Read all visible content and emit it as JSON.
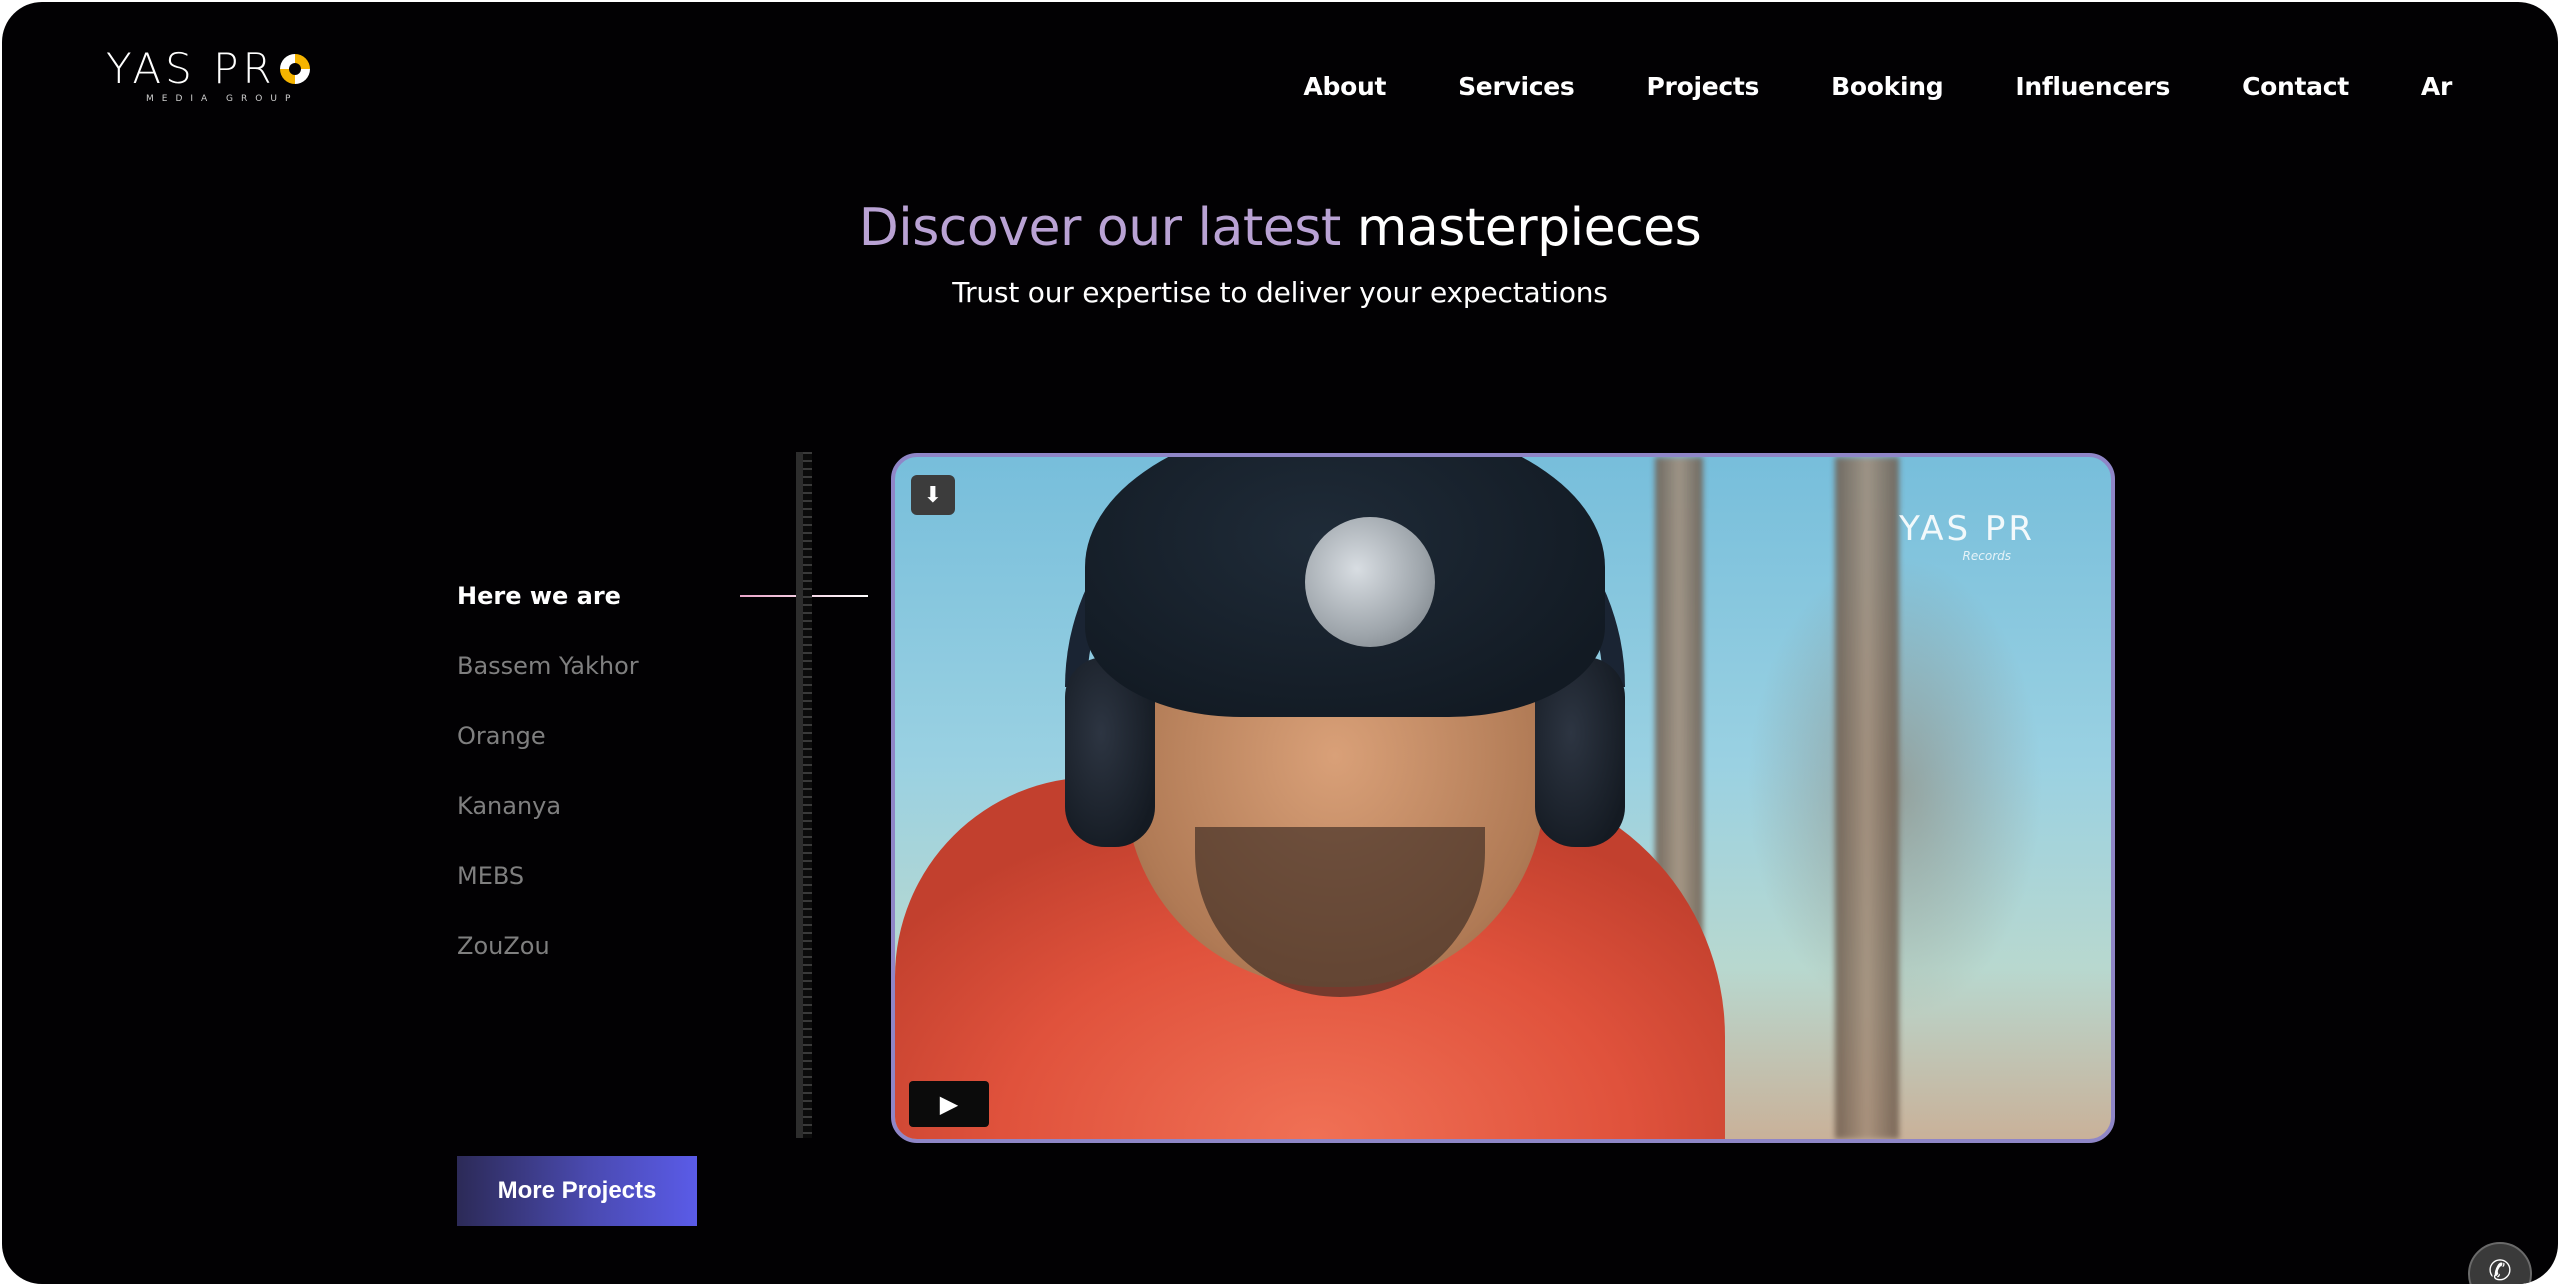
{
  "logo": {
    "main": "YAS PR",
    "sub": "MEDIA GROUP"
  },
  "nav": {
    "items": [
      "About",
      "Services",
      "Projects",
      "Booking",
      "Influencers",
      "Contact",
      "Ar"
    ]
  },
  "hero": {
    "title_accent": "Discover our latest",
    "title_rest": "masterpieces",
    "subtitle": "Trust our expertise to deliver your expectations"
  },
  "projects": {
    "items": [
      "Here we are",
      "Bassem Yakhor",
      "Orange",
      "Kananya",
      "MEBS",
      "ZouZou"
    ],
    "active": "Here we are"
  },
  "video": {
    "watermark": "YAS PR",
    "watermark_sub": "Records",
    "download_icon": "download-icon",
    "play_icon": "play-icon"
  },
  "more_button": {
    "label": "More Projects"
  },
  "colors": {
    "background": "#020103",
    "accent": "#b9a2d4",
    "video_border": "#8f86c7",
    "button_start": "#2c2a57",
    "button_end": "#5a5be8",
    "logo_accent": "#f5b400"
  }
}
